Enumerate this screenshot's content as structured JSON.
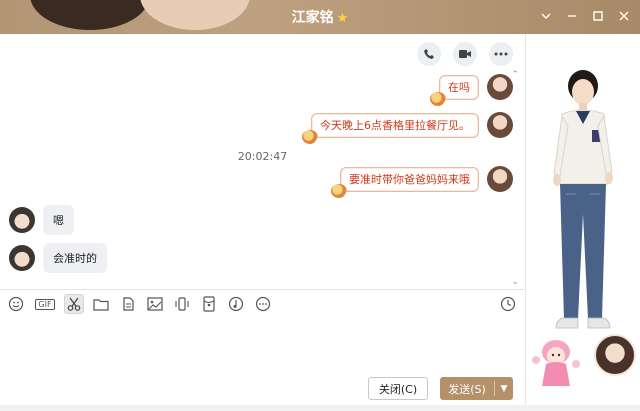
{
  "window": {
    "title": "江家铭",
    "title_badge_icon": "star-icon",
    "controls": [
      "chevron-down-icon",
      "minimize-icon",
      "maximize-icon",
      "close-icon"
    ]
  },
  "header_actions": [
    "phone-icon",
    "video-call-icon",
    "more-icon"
  ],
  "messages": [
    {
      "side": "out",
      "text": "在吗"
    },
    {
      "side": "out",
      "text": "今天晚上6点香格里拉餐厅见。"
    },
    {
      "side": "out",
      "text": "要准时带你爸爸妈妈来哦"
    },
    {
      "side": "in",
      "text": "嗯"
    },
    {
      "side": "in",
      "text": "会准时的"
    }
  ],
  "timestamp": "20:02:47",
  "toolbar": {
    "gif_label": "GIF",
    "items": [
      "emoji-icon",
      "gif-icon",
      "screenshot-scissors-icon",
      "folder-icon",
      "file-doc-icon",
      "image-icon",
      "shake-icon",
      "red-packet-icon",
      "music-icon",
      "more-icon"
    ],
    "history_icon": "clock-icon"
  },
  "buttons": {
    "close": "关闭(C)",
    "send": "发送(S)"
  },
  "colors": {
    "titlebar": "#b29572",
    "send_button": "#b49169",
    "bubble_text": "#d23a1a",
    "bubble_border": "#e8b99f"
  }
}
